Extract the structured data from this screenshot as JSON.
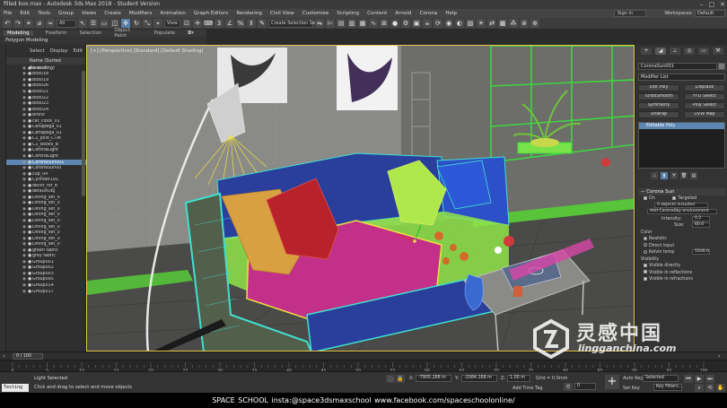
{
  "title": "filled box.max - Autodesk 3ds Max 2018 - Student Version",
  "window_controls": {
    "minimize": "–",
    "maximize": "□",
    "close": "✕"
  },
  "menu": [
    "File",
    "Edit",
    "Tools",
    "Group",
    "Views",
    "Create",
    "Modifiers",
    "Animation",
    "Graph Editors",
    "Rendering",
    "Civil View",
    "Customize",
    "Scripting",
    "Content",
    "Arnold",
    "Corona",
    "Help"
  ],
  "signin": "Sign In",
  "workspaces_label": "Workspaces:",
  "workspace_value": "Default",
  "toolbar": {
    "selection_filter": "All",
    "view_dropdown": "View",
    "create_selection": "Create Selection Se"
  },
  "ribbon": {
    "tabs": [
      "Modeling",
      "Freeform",
      "Selection",
      "Object Paint",
      "Populate"
    ],
    "panel_label": "Polygon Modeling"
  },
  "explorer": {
    "tabs": [
      "Select",
      "Display",
      "Edit"
    ],
    "header": "Name (Sorted Ascending)",
    "items": [
      "Box020",
      "Box018",
      "Box019",
      "Box026",
      "Box021",
      "Box022",
      "Box023",
      "Box024",
      "Bronz",
      "cat_clock_01",
      "Cenapega_01",
      "Cenapega_01",
      "C1_pillo_CTM",
      "C1_Books_B",
      "CoronaLight",
      "CoronaLight",
      "CoronaSun001",
      "CoronaSun00",
      "cup_04",
      "Cylinder191",
      "decor_for_b",
      "defaultOBJ",
      "Dining_set_0",
      "Dining_set_0",
      "Dining_set_0",
      "Dining_set_0",
      "Dining_set_0",
      "Dining_set_0",
      "Dining_set_0",
      "Dining_set_0",
      "Dining_set_0",
      "green fabric",
      "grey fabric",
      "Group001",
      "Group002",
      "Group003",
      "Group005",
      "Group014",
      "Group017"
    ],
    "selected_index": 16
  },
  "viewport": {
    "label": "[+] [Perspective] [Standard] [Default Shading]"
  },
  "command_panel": {
    "object_name": "CoronaSun001",
    "modifier_list": "Modifier List",
    "buttons": [
      "Edit Poly",
      "Displace",
      "TurboSmooth",
      "FFD Select",
      "Symmetry",
      "Poly Select",
      "Unwrap",
      "UVW Map"
    ],
    "stack_item": "Editable Poly",
    "rollout_title": "Corona Sun",
    "on_label": "On",
    "targeted_label": "Targeted",
    "objects_included": "0 objects included",
    "add_env_button": "Add CoronaSky environment",
    "intensity_label": "Intensity:",
    "intensity_value": "0.2",
    "size_label": "Size:",
    "size_value": "60.0",
    "color_section": "Color",
    "color_options": [
      "Realistic",
      "Direct input",
      "Kelvin temp"
    ],
    "color_selected": 0,
    "kelvin_value": "5500.0",
    "visibility_section": "Visibility",
    "visibility_options": [
      "Visible directly",
      "Visible in reflections",
      "Visible in refractions"
    ]
  },
  "time": {
    "frame": "0 / 100",
    "ticks": [
      "0",
      "5",
      "10",
      "15",
      "20",
      "25",
      "30",
      "35",
      "40",
      "45",
      "50",
      "55",
      "60",
      "65",
      "70",
      "75",
      "80",
      "85",
      "90",
      "95",
      "100"
    ]
  },
  "status": {
    "maxscript": "Testing Is",
    "line1": "Light Selected",
    "line2": "Click and drag to select and move objects",
    "x_label": "X:",
    "x_value": "-7905.288 m",
    "y_label": "Y:",
    "y_value": "-2084.168 m",
    "z_label": "Z:",
    "z_value": "1.00 m",
    "grid": "Grid = 0.0mm",
    "add_time_tag": "Add Time Tag",
    "auto_key": "Auto Key",
    "set_key": "Set Key",
    "selected": "Selected",
    "key_filters": "Key Filters..."
  },
  "caption": "SPACE SCHOOL   insta:@space3dsmaxschool   www.facebook.com/spaceschoolonline/",
  "watermark": {
    "cn": "灵感中国",
    "en": "lingganchina.com"
  },
  "colors": {
    "accent": "#5d86b3",
    "viewport_border": "#e6c84a",
    "wire_cyan": "#40e0d0",
    "wire_green": "#8fe34a",
    "wire_magenta": "#d63a8c"
  }
}
